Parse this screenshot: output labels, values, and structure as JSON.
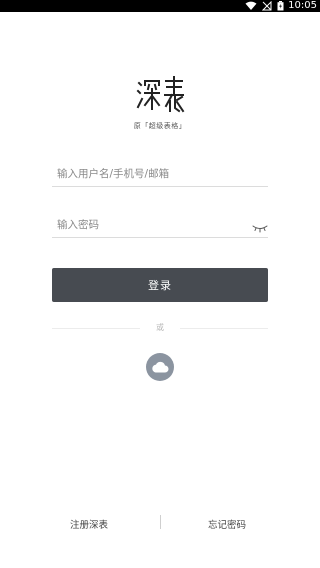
{
  "status_bar": {
    "time": "10:05",
    "icons": [
      "wifi-icon",
      "no-signal-icon",
      "battery-icon"
    ]
  },
  "brand": {
    "logo_text": "深表",
    "subtitle": "原「超级表格」"
  },
  "form": {
    "username_placeholder": "输入用户名/手机号/邮箱",
    "username_value": "",
    "password_placeholder": "输入密码",
    "password_value": "",
    "password_toggle_icon": "eye-closed-icon",
    "login_label": "登录"
  },
  "alt_login": {
    "or_label": "或",
    "icon": "cloud-icon"
  },
  "footer": {
    "register_label": "注册深表",
    "forgot_label": "忘记密码"
  },
  "colors": {
    "primary_button": "#474b51",
    "cloud_button": "#8b94a0",
    "status_bar": "#000000"
  }
}
